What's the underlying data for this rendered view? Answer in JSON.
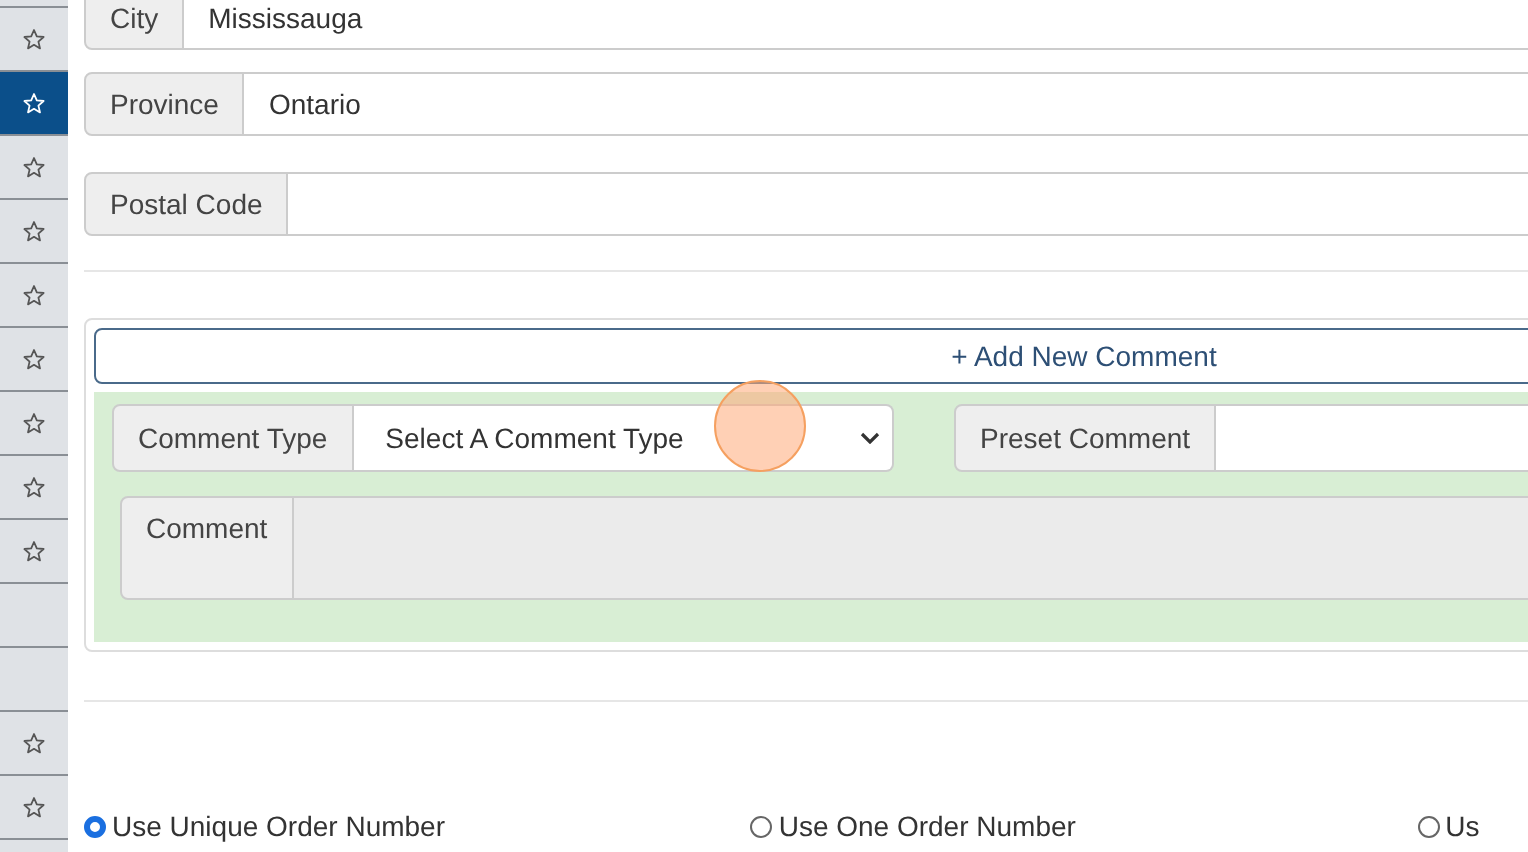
{
  "sidebar": {
    "items": [
      {
        "selected": false
      },
      {
        "star": true,
        "selected": false
      },
      {
        "star": true,
        "selected": true
      },
      {
        "star": true,
        "selected": false
      },
      {
        "star": true,
        "selected": false
      },
      {
        "star": true,
        "selected": false
      },
      {
        "star": true,
        "selected": false
      },
      {
        "star": true,
        "selected": false
      },
      {
        "star": true,
        "selected": false
      },
      {
        "star": true,
        "selected": false
      },
      {
        "star": false,
        "selected": false
      },
      {
        "star": false,
        "selected": false
      },
      {
        "star": true,
        "selected": false
      },
      {
        "star": true,
        "selected": false
      },
      {
        "selected": false
      }
    ]
  },
  "address_fields": [
    {
      "label": "City",
      "value": "Mississauga"
    },
    {
      "label": "Province",
      "value": "Ontario"
    },
    {
      "label": "Postal Code"
    }
  ],
  "comments": {
    "add_button": "+ Add New Comment",
    "comment_type": {
      "label": "Comment Type",
      "value": "Select A Comment Type"
    },
    "preset_comment": {
      "label": "Preset Comment"
    },
    "comment": {
      "label": "Comment"
    }
  },
  "order_number_options": [
    {
      "label": "Use Unique Order Number",
      "selected": true
    },
    {
      "label": "Use One Order Number",
      "selected": false
    },
    {
      "label": "Us",
      "selected": false
    }
  ]
}
